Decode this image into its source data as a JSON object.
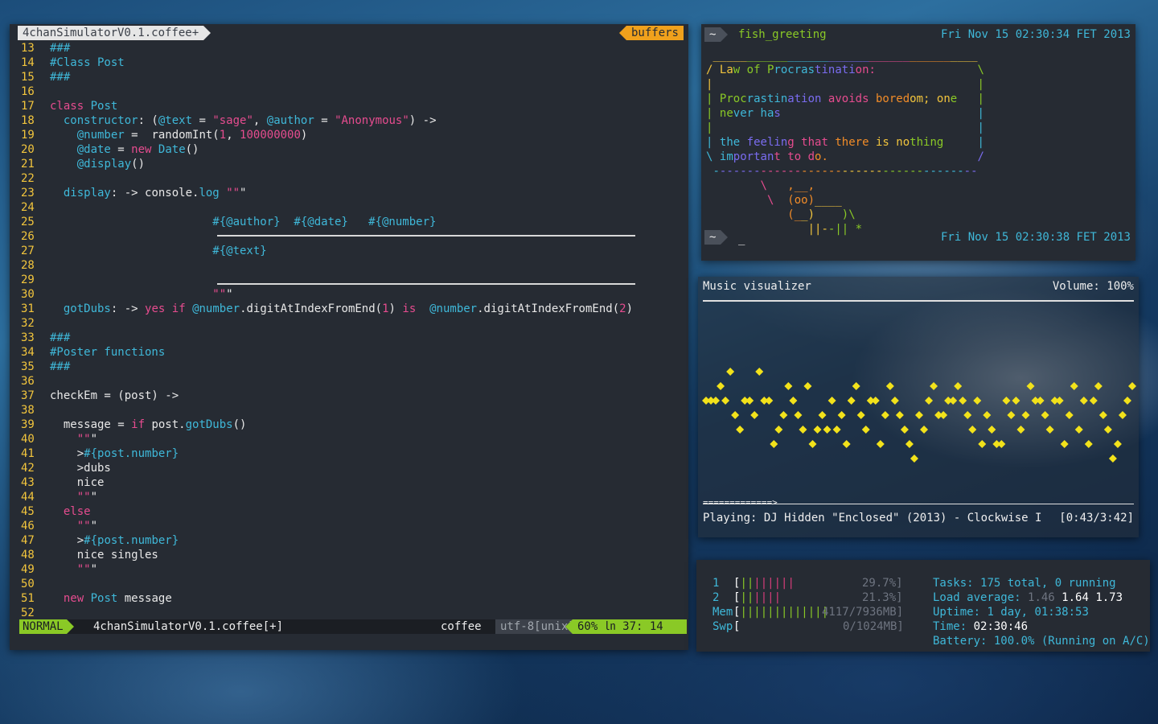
{
  "vim": {
    "tab_active": "4chanSimulatorV0.1.coffee+",
    "tab_buffers": "buffers",
    "lines": [
      {
        "n": "13",
        "t": "###"
      },
      {
        "n": "14",
        "t": "#Class Post"
      },
      {
        "n": "15",
        "t": "###"
      },
      {
        "n": "16",
        "t": ""
      },
      {
        "n": "17",
        "t": "class Post"
      },
      {
        "n": "18",
        "t": "  constructor: (@text = \"sage\", @author = \"Anonymous\") ->"
      },
      {
        "n": "19",
        "t": "    @number =  randomInt(1, 100000000)"
      },
      {
        "n": "20",
        "t": "    @date = new Date()"
      },
      {
        "n": "21",
        "t": "    @display()"
      },
      {
        "n": "22",
        "t": ""
      },
      {
        "n": "23",
        "t": "  display: -> console.log \"\"\""
      },
      {
        "n": "24",
        "t": ""
      },
      {
        "n": "25",
        "t": "                        #{@author}  #{@date}   #{@number}"
      },
      {
        "n": "26",
        "t": ""
      },
      {
        "n": "27",
        "t": "                        #{@text}"
      },
      {
        "n": "28",
        "t": ""
      },
      {
        "n": "29",
        "t": ""
      },
      {
        "n": "30",
        "t": "                        \"\"\""
      },
      {
        "n": "31",
        "t": "  gotDubs: -> yes if @number.digitAtIndexFromEnd(1) is  @number.digitAtIndexFromEnd(2)"
      },
      {
        "n": "32",
        "t": ""
      },
      {
        "n": "33",
        "t": "###"
      },
      {
        "n": "34",
        "t": "#Poster functions"
      },
      {
        "n": "35",
        "t": "###"
      },
      {
        "n": "36",
        "t": ""
      },
      {
        "n": "37",
        "t": "checkEm = (post) ->"
      },
      {
        "n": "38",
        "t": ""
      },
      {
        "n": "39",
        "t": "  message = if post.gotDubs()"
      },
      {
        "n": "40",
        "t": "    \"\"\""
      },
      {
        "n": "41",
        "t": "    >#{post.number}"
      },
      {
        "n": "42",
        "t": "    >dubs"
      },
      {
        "n": "43",
        "t": "    nice"
      },
      {
        "n": "44",
        "t": "    \"\"\""
      },
      {
        "n": "45",
        "t": "  else"
      },
      {
        "n": "46",
        "t": "    \"\"\""
      },
      {
        "n": "47",
        "t": "    >#{post.number}"
      },
      {
        "n": "48",
        "t": "    nice singles"
      },
      {
        "n": "49",
        "t": "    \"\"\""
      },
      {
        "n": "50",
        "t": ""
      },
      {
        "n": "51",
        "t": "  new Post message"
      },
      {
        "n": "52",
        "t": ""
      }
    ],
    "status": {
      "mode": "NORMAL",
      "file": "4chanSimulatorV0.1.coffee[+]",
      "filetype": "coffee",
      "encoding": "utf-8[unix]",
      "position": "60% ㏑  37: 14"
    }
  },
  "fish": {
    "prompt1": "~",
    "command": "fish_greeting",
    "datetime1": "Fri Nov 15 02:30:34 FET 2013",
    "cow_lines": [
      " _______________________________________",
      "/ Law of Procrastination:               \\",
      "|                                       |",
      "| Procrastination avoids boredom; one   |",
      "| never has                             |",
      "|                                       |",
      "| the feeling that there is nothing     |",
      "\\ important to do.                      /",
      " ---------------------------------------",
      "        \\   ,__,",
      "         \\  (oo)____",
      "            (__)    )\\",
      "               ||--|| *"
    ],
    "prompt2": "~",
    "cursor": "_",
    "datetime2": "Fri Nov 15 02:30:38 FET 2013"
  },
  "music": {
    "title": "Music visualizer",
    "volume": "Volume: 100%",
    "progress_bar": "=============>",
    "playing": "Playing: DJ Hidden \"Enclosed\" (2013) - Clockwise I",
    "time": "[0:43/3:42]",
    "viz_color": "#f2e21b",
    "viz_levels": [
      3,
      3,
      3,
      2,
      3,
      1,
      4,
      5,
      3,
      3,
      4,
      1,
      3,
      3,
      6,
      5,
      4,
      2,
      3,
      4,
      5,
      2,
      6,
      5,
      4,
      5,
      3,
      5,
      4,
      6,
      3,
      2,
      4,
      5,
      3,
      3,
      6,
      4,
      2,
      3,
      4,
      5,
      6,
      7,
      4,
      5,
      3,
      2,
      4,
      4,
      3,
      3,
      2,
      3,
      4,
      5,
      3,
      6,
      4,
      5,
      6,
      6,
      3,
      4,
      3,
      5,
      4,
      2,
      3,
      3,
      4,
      5,
      3,
      3,
      6,
      4,
      2,
      5,
      3,
      6,
      3,
      2,
      4,
      5,
      7,
      6,
      4,
      3,
      2
    ]
  },
  "htop": {
    "cpu1_label": "1",
    "cpu1_bar": "[||||||||",
    "cpu1_val": "29.7%]",
    "cpu2_label": "2",
    "cpu2_bar": "[||||||",
    "cpu2_val": "21.3%]",
    "mem_label": "Mem",
    "mem_bar": "[|||||||||||||",
    "mem_val": "4117/7936MB]",
    "swp_label": "Swp",
    "swp_bar": "[",
    "swp_val": "0/1024MB]",
    "tasks_label": "Tasks:",
    "tasks_val": "175 total, 0 running",
    "load_label": "Load average:",
    "load1": "1.46",
    "load5": "1.64",
    "load15": "1.73",
    "uptime_label": "Uptime:",
    "uptime_val": "1 day, 01:38:53",
    "time_label": "Time:",
    "time_val": "02:30:46",
    "battery_label": "Battery:",
    "battery_val": "100.0% (Running on A/C)"
  }
}
